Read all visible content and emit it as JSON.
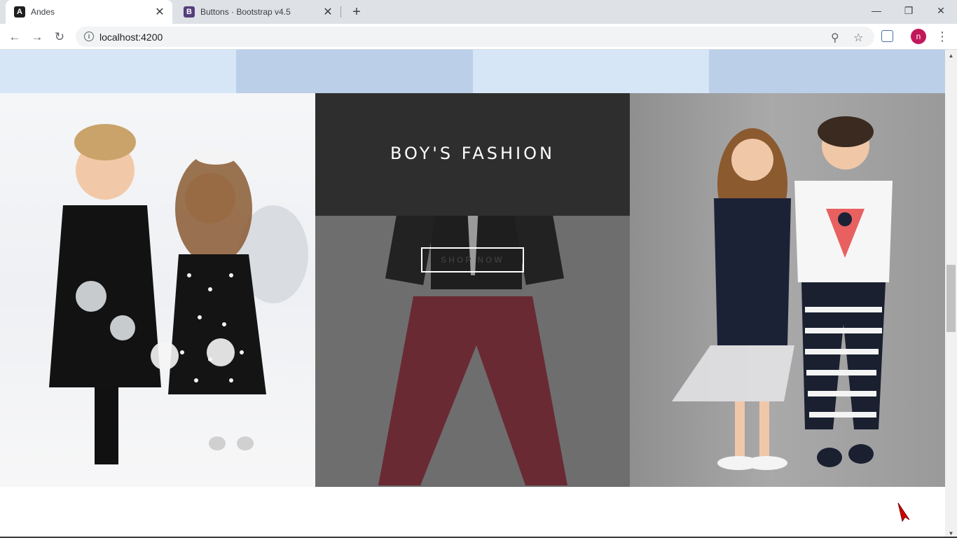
{
  "browser": {
    "tabs": [
      {
        "title": "Andes",
        "favicon": "angular-icon",
        "active": true
      },
      {
        "title": "Buttons · Bootstrap v4.5",
        "favicon": "bootstrap-icon",
        "active": false
      }
    ],
    "url": "localhost:4200",
    "profile_initial": "n",
    "profile_color": "#c2185b"
  },
  "page": {
    "top_strip_colors": [
      "#d6e6f7",
      "#bccfe9",
      "#d6e6f7",
      "#bccfe9"
    ],
    "banner": {
      "title": "BOY'S FASHION",
      "button_label": "SHOP NOW"
    }
  },
  "colors": {
    "header_overlay": "#2e2e2e",
    "overlay_body": "#6e6e6e"
  }
}
